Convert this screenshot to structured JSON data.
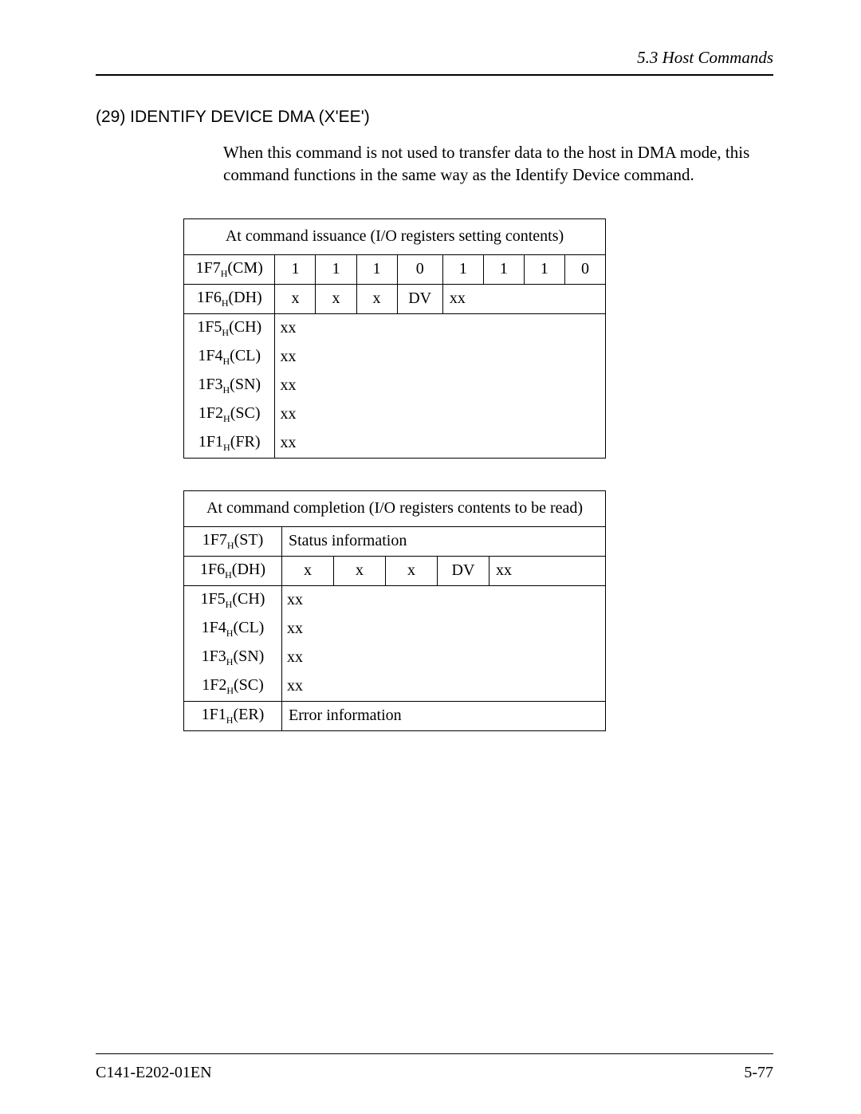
{
  "header": {
    "section": "5.3  Host Commands"
  },
  "section_title": "(29)  IDENTIFY DEVICE DMA (X'EE')",
  "description": "When this command is not used to transfer data to the host in DMA mode, this command functions in the same way as the Identify Device command.",
  "table1": {
    "caption": "At command issuance (I/O registers setting contents)",
    "rows": {
      "cm": {
        "label_prefix": "1F7",
        "label_suffix": "(CM)",
        "bits": [
          "1",
          "1",
          "1",
          "0",
          "1",
          "1",
          "1",
          "0"
        ]
      },
      "dh": {
        "label_prefix": "1F6",
        "label_suffix": "(DH)",
        "bits": [
          "x",
          "x",
          "x",
          "DV",
          "xx"
        ]
      },
      "ch": {
        "label_prefix": "1F5",
        "label_suffix": "(CH)",
        "value": "xx"
      },
      "cl": {
        "label_prefix": "1F4",
        "label_suffix": "(CL)",
        "value": "xx"
      },
      "sn": {
        "label_prefix": "1F3",
        "label_suffix": "(SN)",
        "value": "xx"
      },
      "sc": {
        "label_prefix": "1F2",
        "label_suffix": "(SC)",
        "value": "xx"
      },
      "fr": {
        "label_prefix": "1F1",
        "label_suffix": "(FR)",
        "value": "xx"
      }
    }
  },
  "table2": {
    "caption": "At command completion (I/O registers contents to be read)",
    "rows": {
      "st": {
        "label_prefix": "1F7",
        "label_suffix": "(ST)",
        "value": "Status information"
      },
      "dh": {
        "label_prefix": "1F6",
        "label_suffix": "(DH)",
        "bits": [
          "x",
          "x",
          "x",
          "DV",
          "xx"
        ]
      },
      "ch": {
        "label_prefix": "1F5",
        "label_suffix": "(CH)",
        "value": "xx"
      },
      "cl": {
        "label_prefix": "1F4",
        "label_suffix": "(CL)",
        "value": "xx"
      },
      "sn": {
        "label_prefix": "1F3",
        "label_suffix": "(SN)",
        "value": "xx"
      },
      "sc": {
        "label_prefix": "1F2",
        "label_suffix": "(SC)",
        "value": "xx"
      },
      "er": {
        "label_prefix": "1F1",
        "label_suffix": "(ER)",
        "value": "Error information"
      }
    }
  },
  "footer": {
    "left": "C141-E202-01EN",
    "right": "5-77"
  },
  "subscript_H": "H"
}
